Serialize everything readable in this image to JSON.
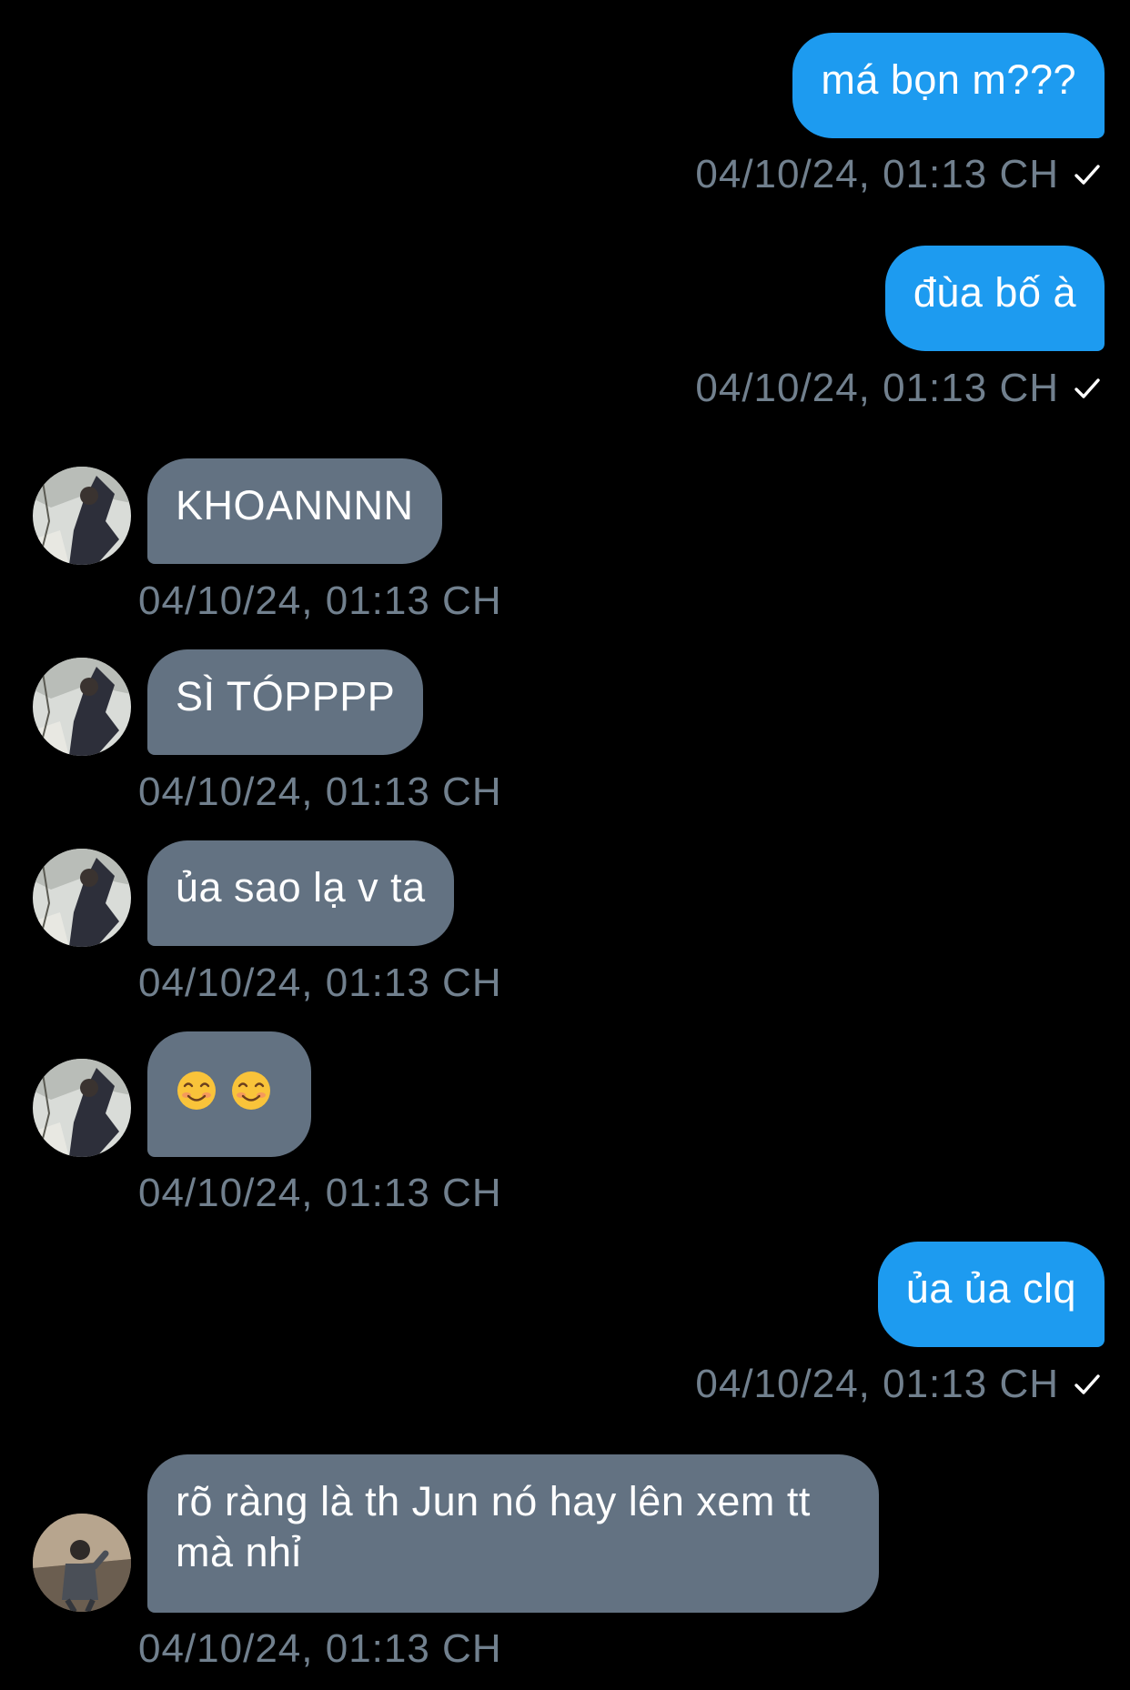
{
  "messages": [
    {
      "id": "m1",
      "direction": "sent",
      "text": "má bọn m???",
      "timestamp": "04/10/24, 01:13 CH",
      "read": true
    },
    {
      "id": "m2",
      "direction": "sent",
      "text": "đùa bố à",
      "timestamp": "04/10/24, 01:13 CH",
      "read": true
    },
    {
      "id": "m3",
      "direction": "received",
      "text": "KHOANNNN",
      "timestamp": "04/10/24, 01:13 CH",
      "avatar": "avatar-a"
    },
    {
      "id": "m4",
      "direction": "received",
      "text": "SÌ TÓPPPP",
      "timestamp": "04/10/24, 01:13 CH",
      "avatar": "avatar-a"
    },
    {
      "id": "m5",
      "direction": "received",
      "text": "ủa sao lạ v ta",
      "timestamp": "04/10/24, 01:13 CH",
      "avatar": "avatar-a"
    },
    {
      "id": "m6",
      "direction": "received",
      "emoji": [
        "smiling-face-emoji",
        "smiling-face-emoji"
      ],
      "timestamp": "04/10/24, 01:13 CH",
      "avatar": "avatar-a"
    },
    {
      "id": "m7",
      "direction": "sent",
      "text": "ủa ủa clq",
      "timestamp": "04/10/24, 01:13 CH",
      "read": true
    },
    {
      "id": "m8",
      "direction": "received",
      "text": "rõ ràng là th Jun nó hay lên xem tt mà nhỉ",
      "timestamp": "04/10/24, 01:13 CH",
      "avatar": "avatar-b"
    }
  ],
  "icons": {
    "read_receipt": "check-icon"
  },
  "colors": {
    "background": "#000000",
    "sent_bubble": "#1D9BF0",
    "received_bubble": "#637282",
    "timestamp": "#71808E"
  }
}
